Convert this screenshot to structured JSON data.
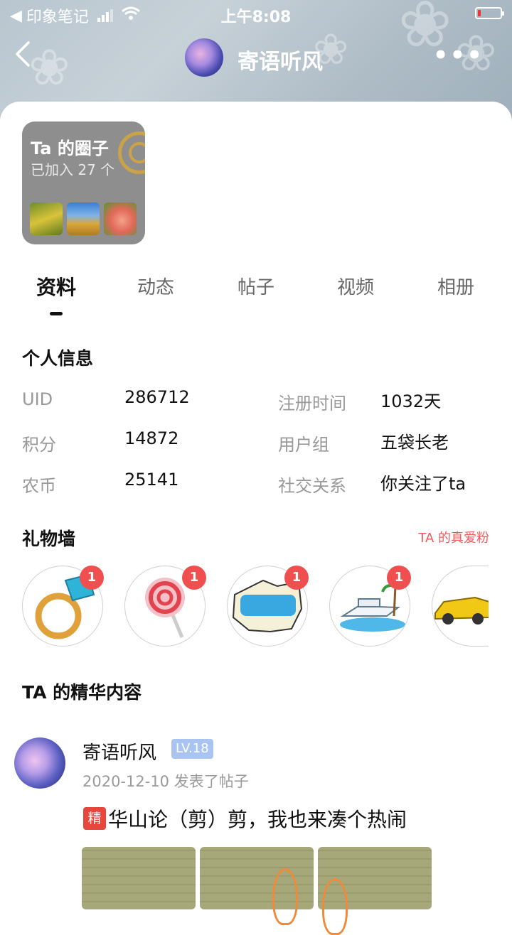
{
  "status_bar": {
    "carrier": "印象笔记",
    "time": "上午8:08"
  },
  "nav": {
    "title": "寄语听风",
    "more_icon": "more-dots-icon",
    "back_icon": "chevron-left-icon"
  },
  "circle": {
    "title": "Ta 的圈子",
    "subtitle": "已加入 27 个"
  },
  "tabs": [
    "资料",
    "动态",
    "帖子",
    "视频",
    "相册"
  ],
  "active_tab": "资料",
  "profile": {
    "section_title": "个人信息",
    "rows": [
      {
        "label": "UID",
        "value": "286712",
        "label2": "注册时间",
        "value2": "1032天"
      },
      {
        "label": "积分",
        "value": "14872",
        "label2": "用户组",
        "value2": "五袋长老"
      },
      {
        "label": "农币",
        "value": "25141",
        "label2": "社交关系",
        "value2": "你关注了ta"
      }
    ]
  },
  "gifts": {
    "section_title": "礼物墙",
    "true_fans": "TA 的真爱粉",
    "items": [
      {
        "name": "ring",
        "count": "1"
      },
      {
        "name": "lollipop",
        "count": "1"
      },
      {
        "name": "cool",
        "count": "1"
      },
      {
        "name": "yacht",
        "count": "1"
      },
      {
        "name": "sports-car",
        "count": ""
      }
    ]
  },
  "featured": {
    "section_title": "TA 的精华内容",
    "post": {
      "author": "寄语听风",
      "level": "LV.18",
      "meta": "2020-12-10 发表了帖子",
      "tag": "精",
      "title": "华山论（剪）剪，我也来凑个热闹"
    }
  },
  "colors": {
    "accent_red": "#f04f4f",
    "level_badge": "#a9c4f0",
    "true_fans": "#f05a5a"
  }
}
